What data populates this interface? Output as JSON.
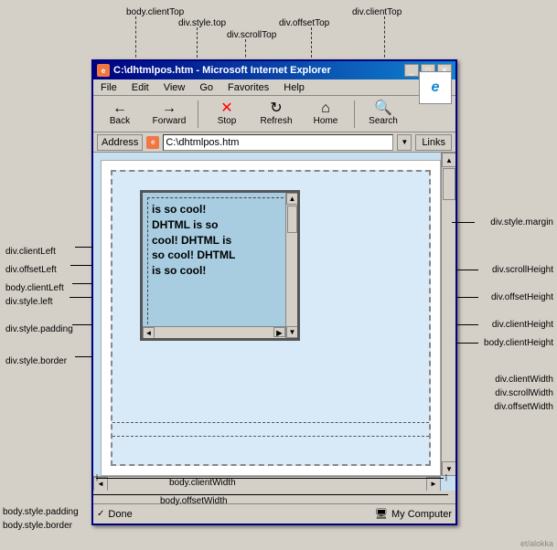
{
  "diagram": {
    "topLabels": {
      "bodyClientTop": "body.clientTop",
      "divStyleTop": "div.style.top",
      "divScrollTop": "div.scrollTop",
      "divOffsetTop": "div.offsetTop",
      "divClientTop2": "div.clientTop"
    },
    "leftLabels": {
      "divClientLeft": "div.clientLeft",
      "divOffsetLeft": "div.offsetLeft",
      "bodyClientLeft": "body.clientLeft",
      "divStyleLeft": "div.style.left",
      "divStylePadding": "div.style.padding",
      "divStyleBorder": "div.style.border",
      "bodyStylePadding": "body.style.padding",
      "bodyStyleBorder": "body.style.border"
    },
    "rightLabels": {
      "divStyleMargin": "div.style.margin",
      "divScrollHeight": "div.scrollHeight",
      "divOffsetHeight": "div.offsetHeight",
      "divClientHeight": "div.clientHeight",
      "bodyClientHeight": "body.clientHeight",
      "divClientWidth": "div.clientWidth",
      "divScrollWidth": "div.scrollWidth",
      "divOffsetWidth": "div.offsetWidth"
    },
    "bottomLabels": {
      "bodyClientWidth": "body.clientWidth",
      "bodyOffsetWidth": "body.offsetWidth"
    },
    "content": "DHTML is so cool! DHTML is so cool! DHTML is so cool! DHTML is so cool! DHTML is"
  },
  "browser": {
    "title": "C:\\dhtmlpos.htm - Microsoft Internet Explorer",
    "menuItems": [
      "File",
      "Edit",
      "View",
      "Go",
      "Favorites",
      "Help"
    ],
    "toolbar": {
      "back": "Back",
      "forward": "Forward",
      "stop": "Stop",
      "refresh": "Refresh",
      "home": "Home",
      "search": "Search"
    },
    "addressLabel": "Address",
    "addressValue": "C:\\dhtmlpos.htm",
    "linksLabel": "Links",
    "status": "Done",
    "zone": "My Computer"
  }
}
